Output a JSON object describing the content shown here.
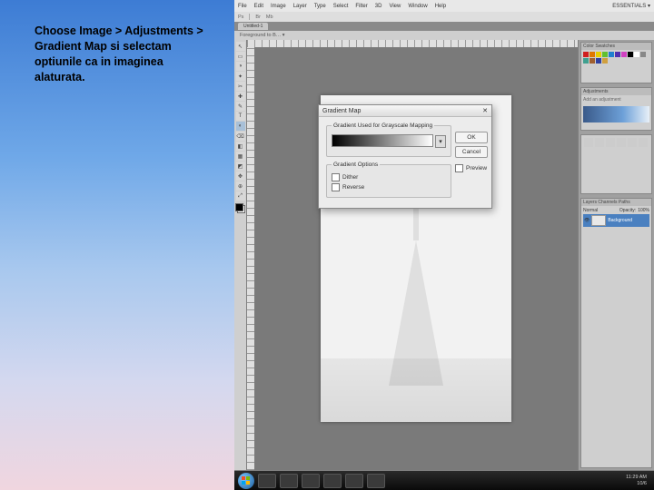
{
  "instruction_text": "Choose Image > Adjustments > Gradient Map si selectam optiunile ca in imaginea alaturata.",
  "menubar": {
    "items": [
      "File",
      "Edit",
      "Image",
      "Layer",
      "Type",
      "Select",
      "Filter",
      "3D",
      "View",
      "Window",
      "Help"
    ],
    "right": "ESSENTIALS ▾"
  },
  "subbar": {
    "left": "Ps",
    "items": [
      "Br",
      "Mb"
    ]
  },
  "tabs": {
    "name": "Untitled-1"
  },
  "optbar": {
    "label": "Foreground to B…  ▾"
  },
  "tools": [
    "↖",
    "▭",
    "◑",
    "✦",
    "✂",
    "✚",
    "✎",
    "T",
    "◐",
    "⌫",
    "◧",
    "▦",
    "◩",
    "✥",
    "⊕",
    "⤢"
  ],
  "panels": {
    "swatches_title": "Color  Swatches",
    "adjust_title": "Adjustments",
    "adjust_hint": "Add an adjustment",
    "layers_title": "Layers  Channels  Paths",
    "layers_mode": "Normal",
    "layers_opacity_label": "Opacity:",
    "layers_opacity_val": "100%",
    "layer_name": "Background"
  },
  "dialog": {
    "title": "Gradient Map",
    "group1_legend": "Gradient Used for Grayscale Mapping",
    "group2_legend": "Gradient Options",
    "opt_dither": "Dither",
    "opt_reverse": "Reverse",
    "ok": "OK",
    "cancel": "Cancel",
    "preview": "Preview"
  },
  "swatch_colors": [
    "#d02020",
    "#e07800",
    "#e8d000",
    "#60c030",
    "#2080d0",
    "#5030b0",
    "#d040c0",
    "#000",
    "#fff",
    "#888",
    "#40a090",
    "#a06030",
    "#3040a0",
    "#d0a040"
  ],
  "taskbar": {
    "time": "11:29 AM",
    "date": "10/6"
  }
}
